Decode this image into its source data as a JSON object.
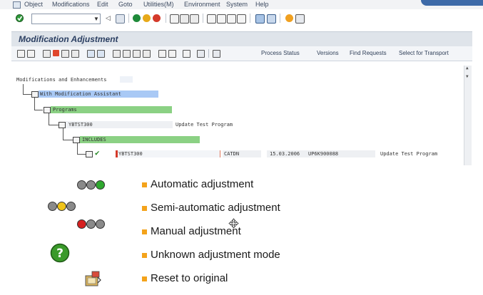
{
  "menu": {
    "items": [
      "Object",
      "Modifications",
      "Edit",
      "Goto",
      "Utilities(M)",
      "Environment",
      "System",
      "Help"
    ]
  },
  "window": {
    "title": "Modification Adjustment"
  },
  "app_toolbar": {
    "buttons": [
      "Process Status",
      "Versions",
      "Find Requests",
      "Select for Transport"
    ]
  },
  "tree": {
    "root": "Modifications and Enhancements",
    "nodes": [
      {
        "label": "With Modification Assistant"
      },
      {
        "label": "Programs"
      },
      {
        "label": "YBTST300",
        "desc": "Update Test Program"
      },
      {
        "label": "INCLUDES"
      }
    ],
    "row": {
      "name": "YBTST300",
      "user": "CATDN",
      "date": "15.03.2006",
      "request": "UP6K900088",
      "desc": "Update Test Program"
    }
  },
  "legend": {
    "items": [
      "Automatic adjustment",
      "Semi-automatic adjustment",
      "Manual adjustment",
      "Unknown adjustment mode",
      "Reset to original"
    ]
  },
  "colors": {
    "tree_blue": "#a9c9f5",
    "tree_green": "#8bd184",
    "bullet_orange": "#f4a31b",
    "light_green": "#2fa82f",
    "light_yellow": "#f0c419",
    "light_red": "#d62020",
    "light_off": "#8a8a8a",
    "help_green": "#3a9a2a"
  }
}
